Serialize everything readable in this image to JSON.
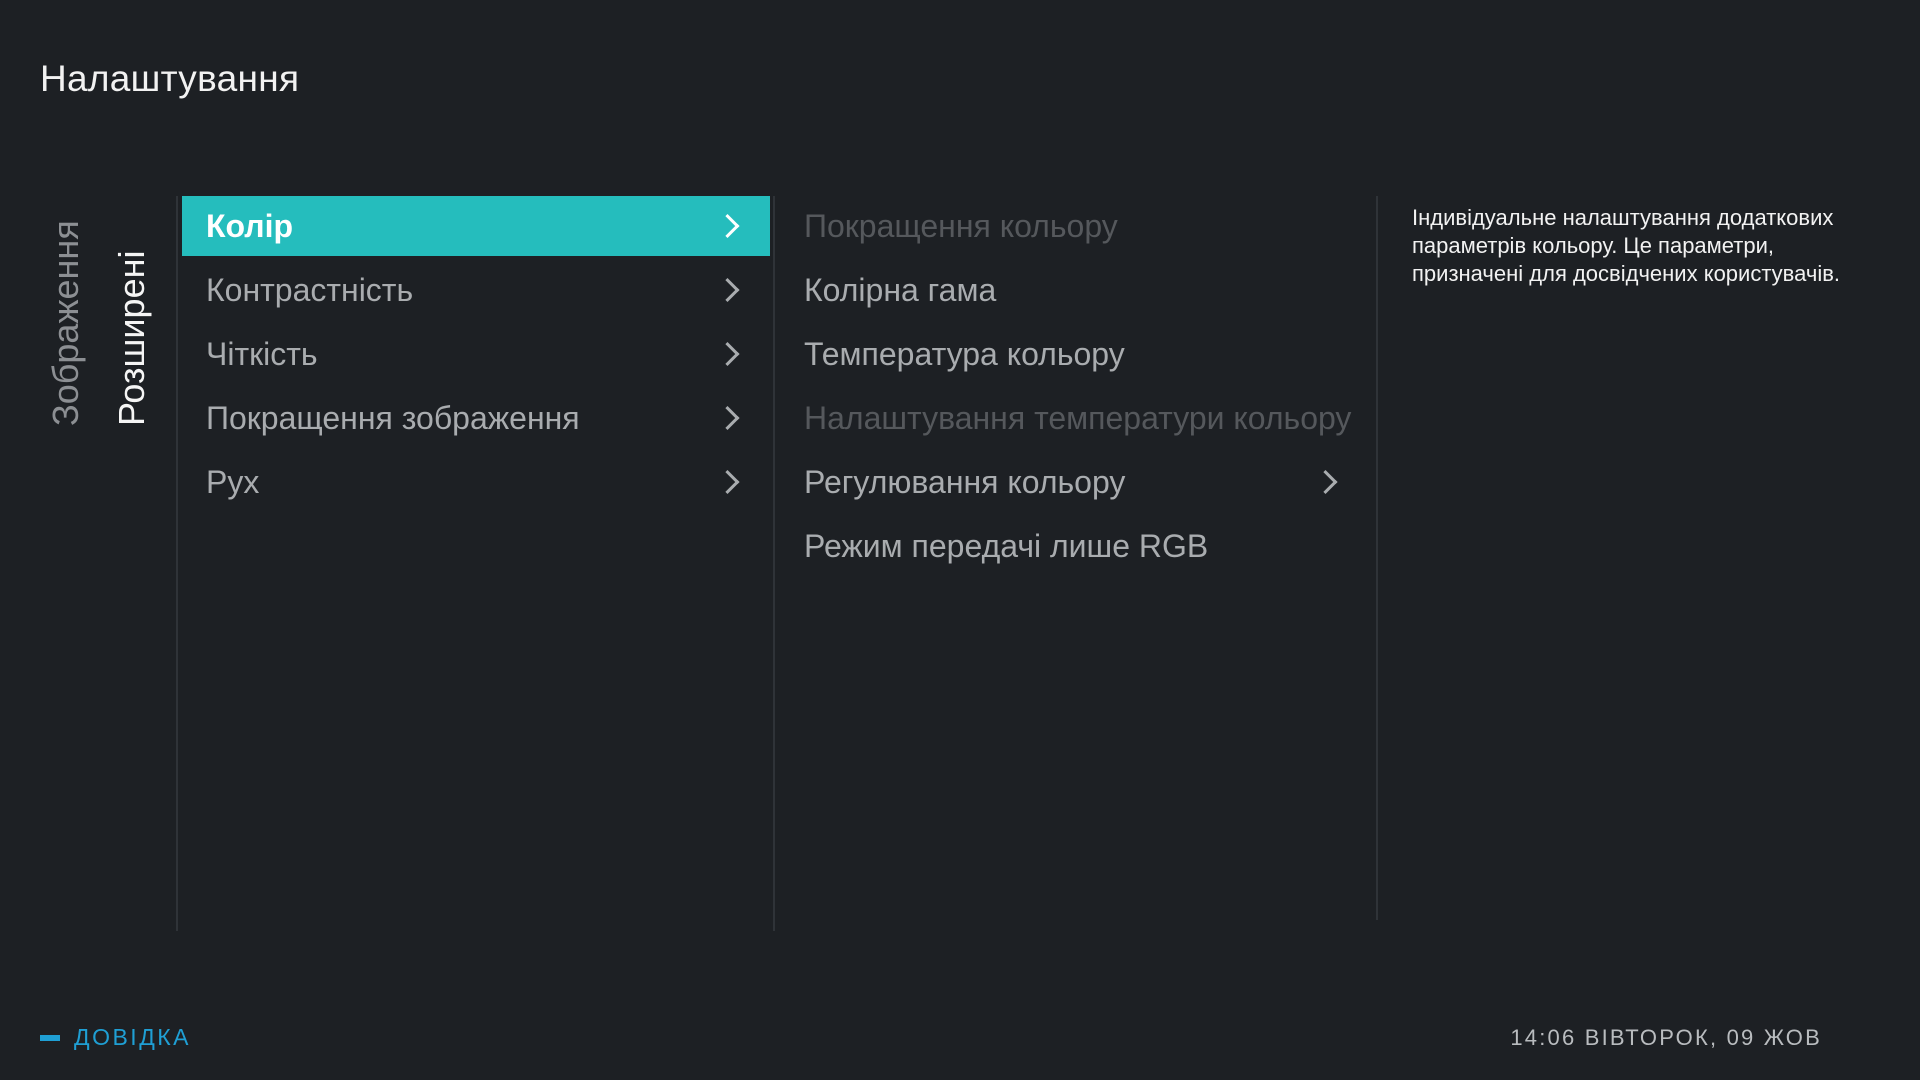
{
  "header": {
    "title": "Налаштування"
  },
  "categories": [
    {
      "label": "Зображення",
      "active": false
    },
    {
      "label": "Розширені",
      "active": true
    }
  ],
  "menu": {
    "items": [
      {
        "label": "Колір",
        "selected": true,
        "has_submenu": true
      },
      {
        "label": "Контрастність",
        "selected": false,
        "has_submenu": true
      },
      {
        "label": "Чіткість",
        "selected": false,
        "has_submenu": true
      },
      {
        "label": "Покращення зображення",
        "selected": false,
        "has_submenu": true
      },
      {
        "label": "Рух",
        "selected": false,
        "has_submenu": true
      }
    ]
  },
  "submenu": {
    "items": [
      {
        "label": "Покращення кольору",
        "disabled": true,
        "has_submenu": false
      },
      {
        "label": "Колірна гама",
        "disabled": false,
        "has_submenu": false
      },
      {
        "label": "Температура кольору",
        "disabled": false,
        "has_submenu": false
      },
      {
        "label": "Налаштування температури кольору",
        "disabled": true,
        "has_submenu": false
      },
      {
        "label": "Регулювання кольору",
        "disabled": false,
        "has_submenu": true
      },
      {
        "label": "Режим передачі лише RGB",
        "disabled": false,
        "has_submenu": false
      }
    ]
  },
  "description": {
    "text": "Індивідуальне налаштування додаткових параметрів кольору. Це параметри, призначені для досвідчених користувачів."
  },
  "footer": {
    "help_label": "ДОВІДКА",
    "clock": "14:06 ВІВТОРОК, 09 ЖОВ"
  },
  "colors": {
    "accent": "#25bdbd",
    "help": "#1f9fd4",
    "background": "#1d2024"
  }
}
